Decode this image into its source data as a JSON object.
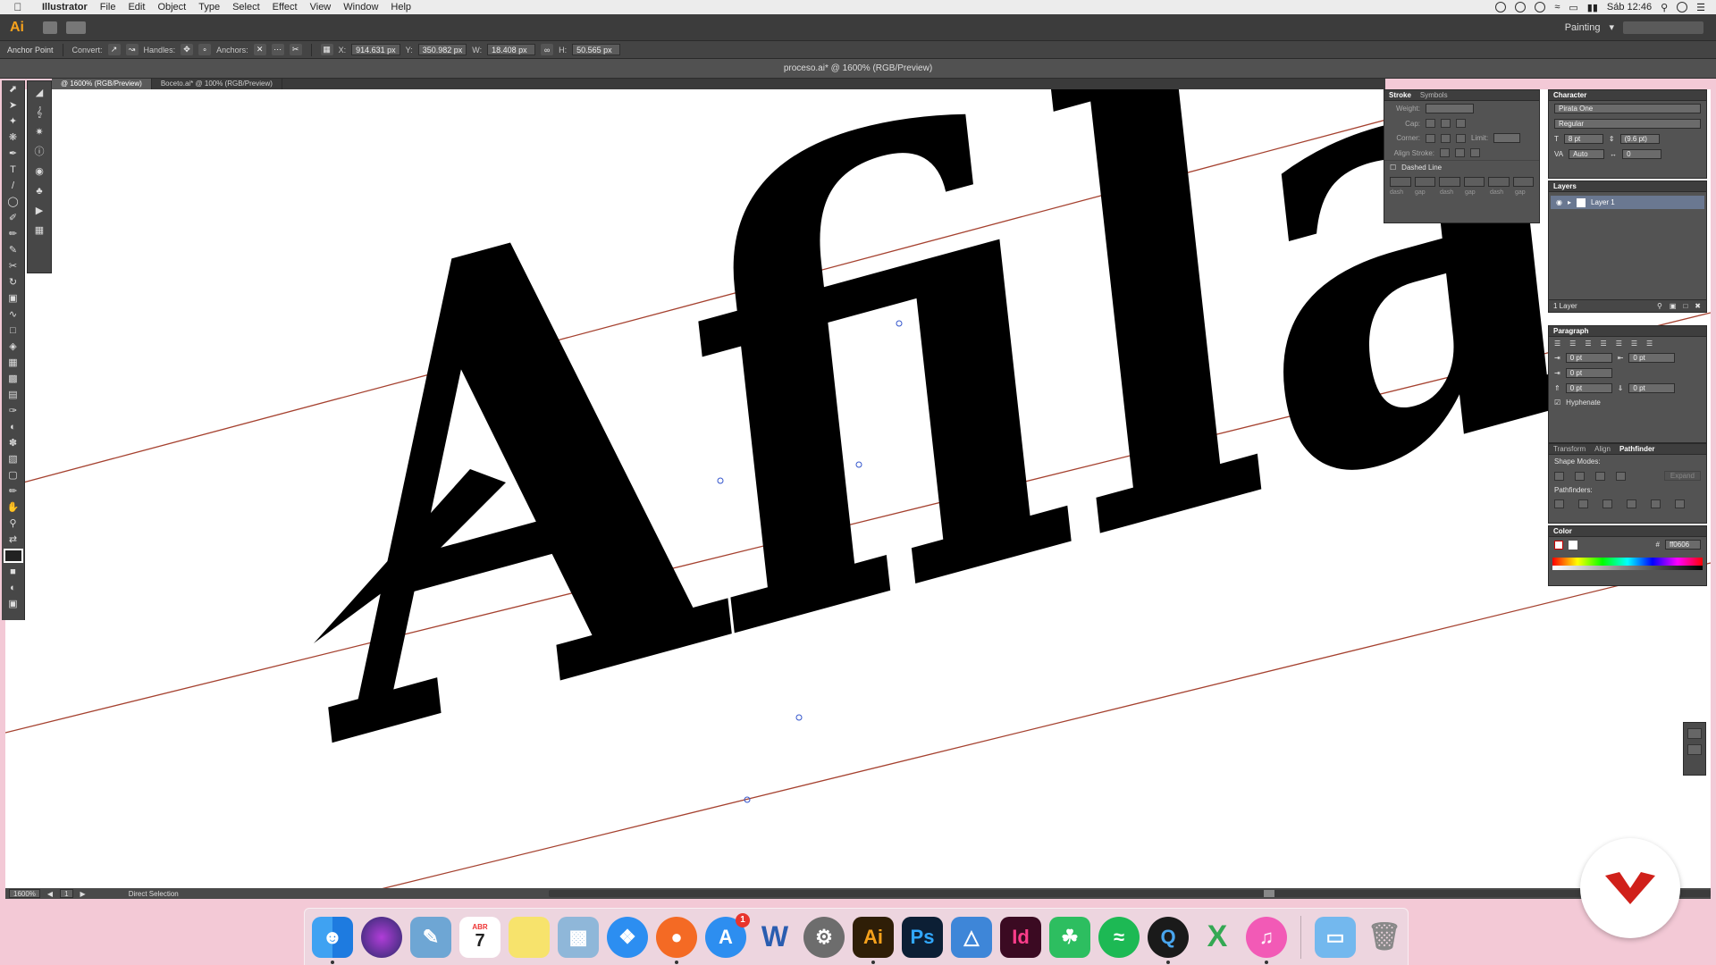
{
  "menubar": {
    "app_name": "Illustrator",
    "items": [
      "File",
      "Edit",
      "Object",
      "Type",
      "Select",
      "Effect",
      "View",
      "Window",
      "Help"
    ],
    "clock": "Sáb 12:46"
  },
  "appbar": {
    "logo": "Ai",
    "workspace": "Painting"
  },
  "controlbar": {
    "tool_name": "Anchor Point",
    "convert_label": "Convert:",
    "handles_label": "Handles:",
    "anchors_label": "Anchors:",
    "x_label": "X:",
    "x_value": "914.631 px",
    "y_label": "Y:",
    "y_value": "350.982 px",
    "w_label": "W:",
    "w_value": "18.408 px",
    "h_label": "H:",
    "h_value": "50.565 px"
  },
  "document": {
    "title": "proceso.ai* @ 1600% (RGB/Preview)",
    "tabs": [
      "@ 1600% (RGB/Preview)",
      "Boceto.ai* @ 100% (RGB/Preview)"
    ],
    "artwork_text": "Afila",
    "guide_color": "#a5412f"
  },
  "status": {
    "zoom": "1600%",
    "page": "1",
    "tool": "Direct Selection"
  },
  "stroke_panel": {
    "tabs": [
      "Stroke",
      "Symbols"
    ],
    "weight_label": "Weight:",
    "cap_label": "Cap:",
    "corner_label": "Corner:",
    "limit_label": "Limit:",
    "align_label": "Align Stroke:",
    "dashed_label": "Dashed Line",
    "dash_labels": [
      "dash",
      "gap",
      "dash",
      "gap",
      "dash",
      "gap"
    ]
  },
  "character_panel": {
    "title": "Character",
    "font": "Pirata One",
    "style": "Regular",
    "size": "8 pt",
    "leading": "(9.6 pt)",
    "kerning": "Auto",
    "tracking": "0"
  },
  "layers_panel": {
    "title": "Layers",
    "layer_name": "Layer 1",
    "count": "1 Layer"
  },
  "paragraph_panel": {
    "title": "Paragraph",
    "indent_left": "0 pt",
    "indent_right": "0 pt",
    "first_line": "0 pt",
    "space_before": "0 pt",
    "space_after": "0 pt",
    "hyphenate": "Hyphenate"
  },
  "pathfinder_panel": {
    "tabs": [
      "Transform",
      "Align",
      "Pathfinder"
    ],
    "shape_modes": "Shape Modes:",
    "expand": "Expand",
    "pathfinders": "Pathfinders:"
  },
  "color_panel": {
    "title": "Color",
    "hex": "ff0606"
  },
  "dock": {
    "calendar_month": "ABR",
    "calendar_day": "7",
    "badge_count": "1",
    "app_labels": [
      "Ai",
      "Ps",
      "Id",
      "W",
      "X"
    ]
  },
  "colors": {
    "accent_ai": "#f7a21c",
    "brand_red": "#d0201a"
  }
}
